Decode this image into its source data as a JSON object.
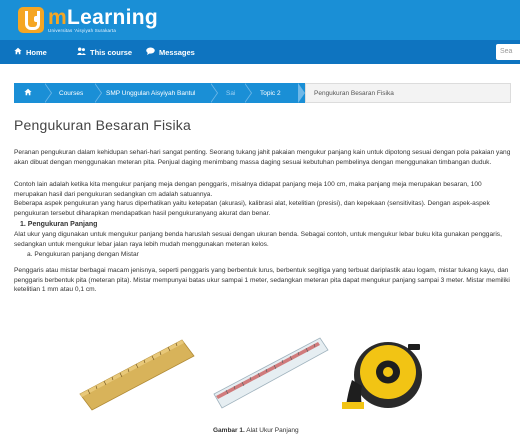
{
  "header": {
    "brand_prefix": "m",
    "brand_rest": "Learning",
    "brand_sub": "Universitas 'Aisyiyah Surakarta"
  },
  "nav": {
    "home": "Home",
    "course": "This course",
    "messages": "Messages",
    "search_placeholder": "Sea"
  },
  "breadcrumb": {
    "items": [
      "Courses",
      "SMP Unggulan Aisyiyah Bantul",
      "Sai",
      "Topic 2"
    ],
    "current": "Pengukuran Besaran Fisika"
  },
  "page": {
    "title": "Pengukuran Besaran Fisika",
    "p1": "Peranan pengukuran dalam kehidupan sehari-hari sangat penting. Seorang tukang jahit pakaian mengukur panjang kain untuk dipotong sesuai dengan pola pakaian yang akan dibuat dengan menggunakan meteran pita. Penjual daging menimbang massa daging sesuai kebutuhan pembelinya dengan menggunakan timbangan duduk.",
    "p2": "Contoh lain adalah ketika kita mengukur panjang meja dengan penggaris, misalnya didapat panjang meja 100 cm, maka panjang meja merupakan besaran, 100 merupakan hasil dari pengukuran sedangkan cm adalah satuannya.",
    "p3": "Beberapa aspek pengukuran yang harus diperhatikan yaitu ketepatan (akurasi), kalibrasi alat, ketelitian (presisi), dan kepekaan (sensitivitas). Dengan aspek-aspek pengukuran tersebut diharapkan mendapatkan hasil pengukuranyang akurat dan benar.",
    "sec1_title": "1. Pengukuran Panjang",
    "sec1_text": "Alat ukur yang digunakan untuk mengukur panjang benda haruslah sesuai dengan ukuran benda. Sebagai contoh, untuk mengukur lebar buku kita gunakan penggaris, sedangkan untuk mengukur lebar jalan raya lebih mudah menggunakan meteran kelos.",
    "sec1a": "a.  Pengukuran panjang dengan Mistar",
    "p4": "Penggaris atau mistar berbagai macam jenisnya, seperti penggaris yang berbentuk lurus, berbentuk segitiga yang terbuat dariplastik atau logam, mistar tukang kayu, dan penggaris berbentuk pita (meteran pita). Mistar mempunyai batas ukur sampai 1 meter, sedangkan meteran pita dapat mengukur panjang sampai 3 meter. Mistar memiliki ketelitian 1 mm atau 0,1 cm.",
    "caption_label": "Gambar 1.",
    "caption_text": "Alat Ukur Panjang"
  },
  "colors": {
    "header": "#1a8fd6",
    "navbar": "#0e74c0",
    "accent": "#f5a623"
  },
  "icons": {
    "home": "home-icon",
    "course": "course-icon",
    "messages": "chat-icon"
  }
}
